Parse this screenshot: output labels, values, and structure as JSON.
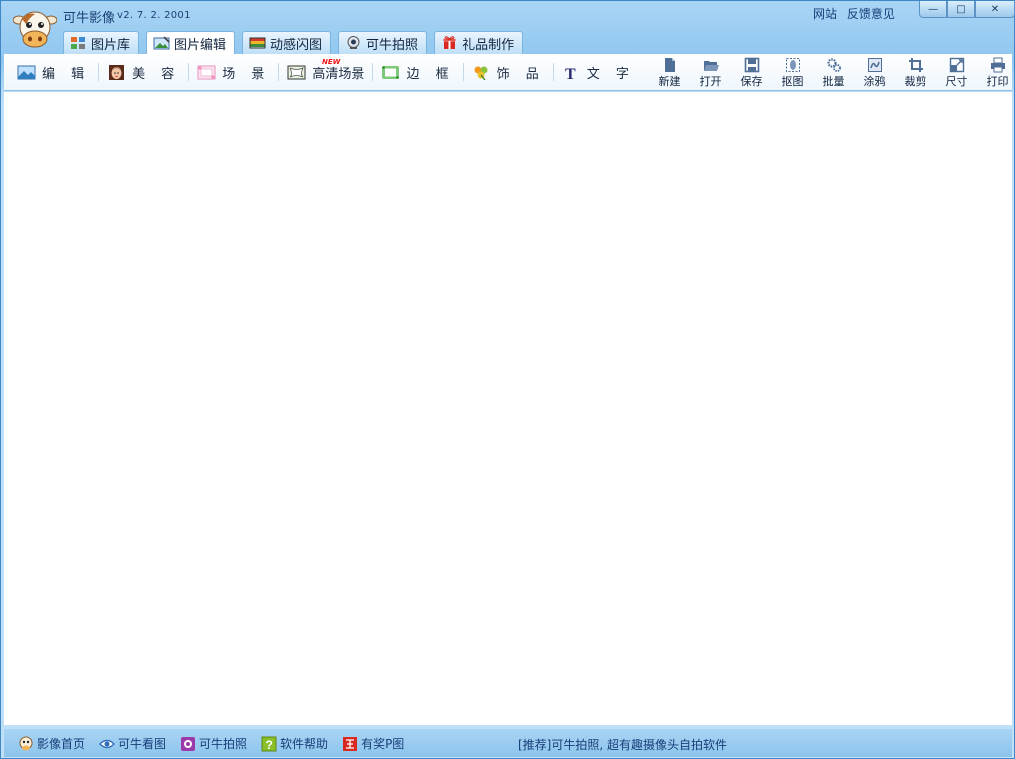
{
  "titlebar": {
    "app_name": "可牛影像",
    "version": "v2. 7. 2. 2001",
    "links": [
      "网站",
      "反馈意见"
    ],
    "controls": {
      "minimize": "—",
      "maximize": "□",
      "close": "✕"
    }
  },
  "tabs": [
    {
      "label": "图片库",
      "icon": "gallery-icon",
      "active": false
    },
    {
      "label": "图片编辑",
      "icon": "photo-edit-icon",
      "active": true
    },
    {
      "label": "动感闪图",
      "icon": "flash-image-icon",
      "active": false
    },
    {
      "label": "可牛拍照",
      "icon": "webcam-icon",
      "active": false
    },
    {
      "label": "礼品制作",
      "icon": "gift-icon",
      "active": false
    }
  ],
  "edit_tools": [
    {
      "label": "编 辑",
      "icon": "landscape-icon"
    },
    {
      "label": "美 容",
      "icon": "face-icon"
    },
    {
      "label": "场 景",
      "icon": "scene-icon"
    },
    {
      "label": "高清场景",
      "icon": "hd-scene-icon",
      "badge": "NEW"
    },
    {
      "label": "边 框",
      "icon": "frame-icon"
    },
    {
      "label": "饰 品",
      "icon": "clover-icon"
    },
    {
      "label": "文 字",
      "icon": "text-t-icon"
    }
  ],
  "actions": [
    {
      "label": "新建",
      "icon": "new-file-icon"
    },
    {
      "label": "打开",
      "icon": "folder-open-icon"
    },
    {
      "label": "保存",
      "icon": "save-icon"
    },
    {
      "label": "抠图",
      "icon": "cutout-icon"
    },
    {
      "label": "批量",
      "icon": "gears-icon"
    },
    {
      "label": "涂鸦",
      "icon": "doodle-icon"
    },
    {
      "label": "裁剪",
      "icon": "crop-icon"
    },
    {
      "label": "尺寸",
      "icon": "resize-icon"
    },
    {
      "label": "打印",
      "icon": "printer-icon"
    }
  ],
  "statusbar": {
    "links": [
      {
        "label": "影像首页",
        "icon": "cow-home-icon"
      },
      {
        "label": "可牛看图",
        "icon": "eye-viewer-icon"
      },
      {
        "label": "可牛拍照",
        "icon": "camera-icon"
      },
      {
        "label": "软件帮助",
        "icon": "help-icon"
      },
      {
        "label": "有奖P图",
        "icon": "prize-icon"
      }
    ],
    "recommend": "[推荐]可牛拍照, 超有趣摄像头自拍软件"
  },
  "colors": {
    "frame": "#8fc6ef",
    "border": "#3f86c4",
    "text": "#163e79",
    "accent_red": "#e11111"
  }
}
